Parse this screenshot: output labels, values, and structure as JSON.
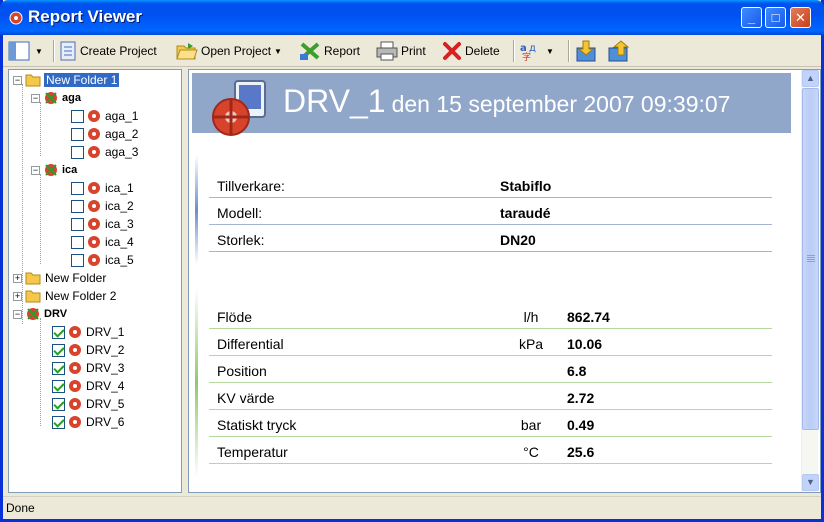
{
  "window": {
    "title": "Report Viewer"
  },
  "toolbar": {
    "create_project": "Create Project",
    "open_project": "Open Project",
    "report": "Report",
    "print": "Print",
    "delete": "Delete"
  },
  "tree": {
    "root": "New Folder 1",
    "groups": [
      {
        "name": "aga",
        "items": [
          "aga_1",
          "aga_2",
          "aga_3"
        ]
      },
      {
        "name": "ica",
        "items": [
          "ica_1",
          "ica_2",
          "ica_3",
          "ica_4",
          "ica_5"
        ]
      }
    ],
    "folders": [
      "New Folder",
      "New Folder 2"
    ],
    "drv": {
      "name": "DRV",
      "items": [
        "DRV_1",
        "DRV_2",
        "DRV_3",
        "DRV_4",
        "DRV_5",
        "DRV_6"
      ]
    }
  },
  "report": {
    "title": "DRV_1",
    "date": "den 15 september 2007 09:39:07",
    "info": [
      {
        "label": "Tillverkare:",
        "value": "Stabiflo"
      },
      {
        "label": "Modell:",
        "value": "taraudé"
      },
      {
        "label": "Storlek:",
        "value": "DN20"
      }
    ],
    "measurements": [
      {
        "label": "Flöde",
        "unit": "l/h",
        "value": "862.74"
      },
      {
        "label": "Differential",
        "unit": "kPa",
        "value": "10.06"
      },
      {
        "label": "Position",
        "unit": "",
        "value": "6.8"
      },
      {
        "label": "KV värde",
        "unit": "",
        "value": "2.72"
      },
      {
        "label": "Statiskt tryck",
        "unit": "bar",
        "value": "0.49"
      },
      {
        "label": "Temperatur",
        "unit": "°C",
        "value": "25.6"
      }
    ]
  },
  "status": {
    "text": "Done"
  }
}
